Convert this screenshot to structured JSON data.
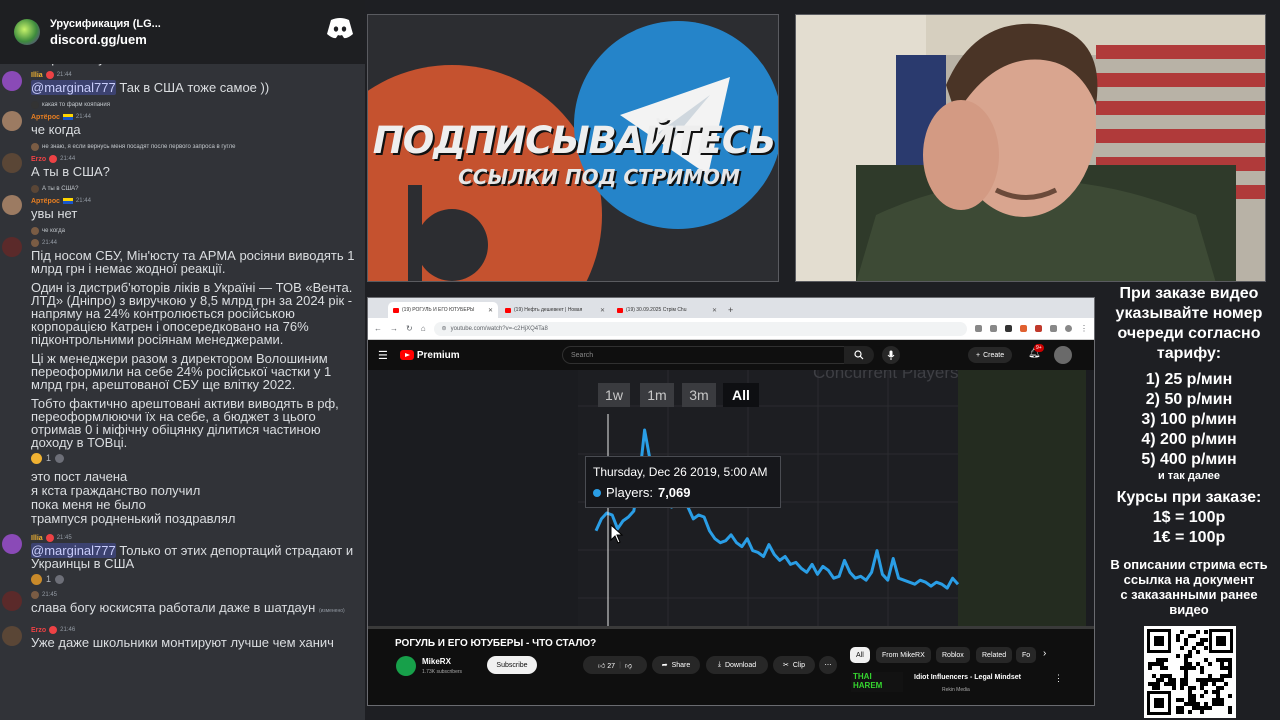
{
  "discord": {
    "server_name": "Урусификация (LG...",
    "invite": "discord.gg/uem"
  },
  "chat": {
    "cut_text": "запроса в гугле",
    "messages": [
      {
        "author": "Illia",
        "time": "21:44",
        "text_mention": "@marginal777",
        "text": " Так в США тоже самое ))"
      },
      {
        "reply_text": "какая то фарм кояпания"
      },
      {
        "author": "Артёрос",
        "time": "21:44",
        "text": "че когда"
      },
      {
        "reply_text": "не знаю, я если вернусь меня посадят после первого запроса в гугле"
      },
      {
        "author": "Erzo",
        "time": "21:44",
        "text": "А ты в США?"
      },
      {
        "reply_text": "А ты в США?"
      },
      {
        "author": "Артёрос",
        "time": "21:44",
        "text": "увы нет"
      },
      {
        "reply_text": "че когда"
      },
      {
        "time": "21:44",
        "paragraphs": [
          "Під носом СБУ, Мін'юсту та АРМА росіяни виводять 1 млрд грн і немає жодної реакції.",
          "Один із дистриб'юторів ліків в Україні — ТОВ «Вента. ЛТД» (Дніпро) з виручкою у 8,5 млрд грн за 2024 рік - напряму на 24% контролюється російською корпорацією Катрен і опосередковано на 76% підконтрольними росіянам менеджерами.",
          "Ці ж менеджери разом з директором Волошиним переоформили на себе 24% російської частки у 1 млрд грн, арештованої СБУ ще влітку 2022.",
          "Тобто фактично арештовані активи виводять в рф, переоформлюючи їх на себе, а бюджет з цього отримав 0 і міфічну обіцянку ділитися частиною доходу в ТОВці."
        ],
        "reaction_count": "1"
      },
      {
        "lines": [
          "это пост лачена",
          "я кста гражданство получил",
          "пока меня не было",
          "трампуся родненький поздравлял"
        ]
      },
      {
        "author": "Illia",
        "time": "21:45",
        "text_mention": "@marginal777",
        "text": " Только от этих депортаций страдают и Украинцы в США",
        "reaction_count": "1"
      },
      {
        "time": "21:45",
        "text": "слава богу юскисята работали даже в шатдаун",
        "tag": "(изменено)"
      },
      {
        "author": "Erzo",
        "time": "21:46",
        "text": "Уже даже школьники монтируют лучше чем ханич"
      }
    ]
  },
  "promo": {
    "title": "ПОДПИСЫВАЙТЕСЬ",
    "subtitle": "ССЫЛКИ ПОД СТРИМОМ"
  },
  "browser": {
    "tabs": [
      "(19) РОГУЛЬ И ЕГО ЮТУБЕРЫ",
      "(19) Нефть дешевеет | Новая",
      "(19) 30.09.2025 Стрім Chu"
    ],
    "url": "youtube.com/watch?v=-c2HjXQ4Ta8",
    "search_placeholder": "Search",
    "create_label": "Create",
    "notif_count": "9+",
    "brand": "Premium"
  },
  "chart_data": {
    "type": "line",
    "title": "Concurrent Players",
    "range_buttons": [
      "1w",
      "1m",
      "3m",
      "All"
    ],
    "selected_range": "All",
    "tooltip": {
      "date": "Thursday, Dec 26 2019, 5:00 AM",
      "label": "Players:",
      "value": "7,069"
    },
    "series": [
      {
        "color": "#2a9ee6",
        "values": [
          6400,
          7000,
          7300,
          7200,
          6500,
          6900,
          7100,
          7400,
          9000,
          11500,
          10000,
          9000,
          8800,
          8200,
          7600,
          8600,
          8000,
          7600,
          7000,
          7200,
          7100,
          6400,
          6000,
          5800,
          5900,
          6200,
          5800,
          5600,
          6000,
          5400,
          5300,
          5100,
          5700,
          5200,
          4900,
          5100,
          4700,
          4800,
          4500,
          4300,
          4700,
          4200,
          4600,
          4400,
          4000,
          4100,
          4900,
          4300,
          4000,
          4100,
          3900,
          4300,
          5400,
          4200,
          3900,
          5000,
          4000,
          3900,
          3800,
          3700,
          3900,
          3800,
          3600,
          3800,
          3700,
          3500,
          4000,
          3700
        ]
      }
    ]
  },
  "video": {
    "title": "РОГУЛЬ И ЕГО ЮТУБЕРЫ - ЧТО СТАЛО?",
    "channel": "MikeRX",
    "subscribers": "1.73K subscribers",
    "subscribe_label": "Subscribe",
    "likes": "27",
    "share_label": "Share",
    "download_label": "Download",
    "clip_label": "Clip",
    "chips": [
      "All",
      "From MikeRX",
      "Roblox",
      "Related",
      "Fo"
    ],
    "rec_thumb_text": "THAI HAREM",
    "rec_title": "Idiot Influencers - Legal Mindset",
    "rec_channel": "Rekin Media"
  },
  "pricing": {
    "header": [
      "При заказе видео",
      "указывайте номер",
      "очереди согласно",
      "тарифу:"
    ],
    "tiers": [
      "1) 25 р/мин",
      "2) 50 р/мин",
      "3) 100 р/мин",
      "4) 200 р/мин",
      "5) 400 р/мин"
    ],
    "etc": "и так далее",
    "rates_header": "Курсы при заказе:",
    "rates": [
      "1$ = 100р",
      "1€ = 100р"
    ],
    "doc_note": [
      "В описании стрима есть",
      "ссылка на документ",
      "с заказанными ранее",
      "видео"
    ]
  }
}
